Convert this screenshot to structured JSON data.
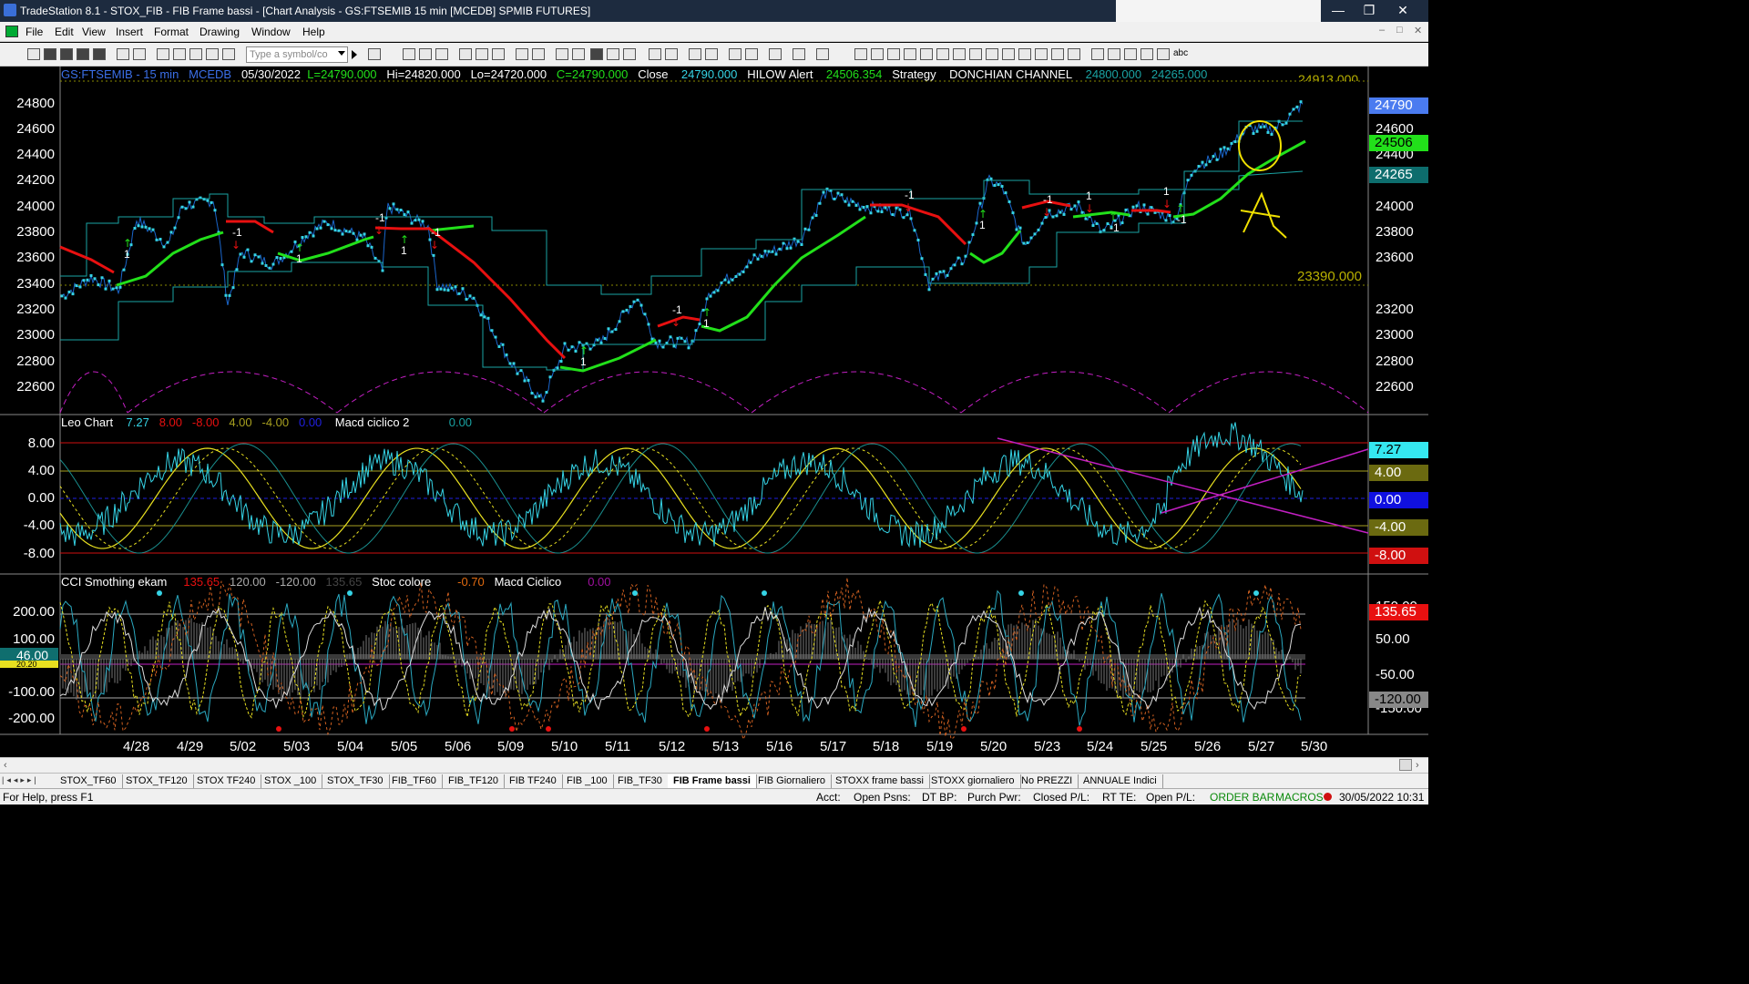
{
  "window": {
    "title": "TradeStation 8.1 - STOX_FIB - FIB Frame bassi - [Chart Analysis - GS:FTSEMIB  15 min  [MCEDB] SPMIB FUTURES]",
    "minimize": "—",
    "restore": "❐",
    "close": "✕"
  },
  "menu": {
    "items": [
      "File",
      "Edit",
      "View",
      "Insert",
      "Format",
      "Drawing",
      "Window",
      "Help"
    ],
    "right_controls": [
      "–",
      "□",
      "✕"
    ]
  },
  "toolbar": {
    "symbol_placeholder": "Type a symbol/co",
    "abc_label": "abc"
  },
  "price_panel": {
    "symbol": "GS:FTSEMIB - 15 min",
    "exchange": "MCEDB",
    "date": "05/30/2022",
    "last": "L=24790.000",
    "high": "Hi=24820.000",
    "low": "Lo=24720.000",
    "close": "C=24790.000",
    "close_label": "Close",
    "close_value": "24790.000",
    "alert_label": "HILOW Alert",
    "alert_value": "24506.354",
    "strategy_label": "Strategy",
    "donchian_label": "DONCHIAN CHANNEL",
    "donchian_hi": "24800.000",
    "donchian_lo": "24265.000",
    "top_value": "24913.000",
    "level_value": "23390.000",
    "y_ticks": [
      "24800",
      "24600",
      "24400",
      "24200",
      "24000",
      "23800",
      "23600",
      "23400",
      "23200",
      "23000",
      "22800",
      "22600"
    ],
    "badges": [
      "24790",
      "24506",
      "24265"
    ],
    "trade_markers": [
      "1",
      "-1",
      "1",
      "-1",
      "1",
      "-1",
      "1",
      "-1",
      "1",
      "-1",
      "1",
      "-1",
      "1",
      "-1",
      "1",
      "-1",
      "1",
      "-1",
      "1"
    ]
  },
  "osc_panel": {
    "name": "Leo Chart",
    "v1": "7.27",
    "v2": "8.00",
    "v3": "-8.00",
    "v4": "4.00",
    "v5": "-4.00",
    "v6": "0.00",
    "macd_label": "Macd ciclico 2",
    "macd_value": "0.00",
    "y_ticks": [
      "8.00",
      "4.00",
      "0.00",
      "-4.00",
      "-8.00"
    ],
    "badges": [
      "7.27",
      "4.00",
      "0.00",
      "-4.00",
      "-8.00"
    ]
  },
  "cci_panel": {
    "name": "CCI Smothing ekam",
    "v1": "135.65",
    "v2": "120.00",
    "v3": "-120.00",
    "v4": "135.65",
    "stoc_label": "Stoc colore",
    "stoc_value": "-0.70",
    "macd_label": "Macd Ciclico",
    "macd_value": "0.00",
    "y_ticks_left": [
      "200.00",
      "100.00",
      "-100.00",
      "-200.00"
    ],
    "y_ticks_right": [
      "150.00",
      "50.00",
      "-50.00",
      "-150.00"
    ],
    "badges_right": [
      "135.65",
      "-120.00"
    ],
    "badges_left": [
      "46.00",
      "20.20"
    ]
  },
  "x_axis": [
    "4/28",
    "4/29",
    "5/02",
    "5/03",
    "5/04",
    "5/05",
    "5/06",
    "5/09",
    "5/10",
    "5/11",
    "5/12",
    "5/13",
    "5/16",
    "5/17",
    "5/18",
    "5/19",
    "5/20",
    "5/23",
    "5/24",
    "5/25",
    "5/26",
    "5/27",
    "5/30"
  ],
  "tabs": [
    "STOX_TF60",
    "STOX_TF120",
    "STOX TF240",
    "STOX _100",
    "STOX_TF30",
    "FIB_TF60",
    "FIB_TF120",
    "FIB TF240",
    "FIB _100",
    "FIB_TF30",
    "FIB Frame bassi",
    "FIB Giornaliero",
    "STOXX frame bassi",
    "STOXX giornaliero",
    "No PREZZI",
    "ANNUALE Indici"
  ],
  "active_tab": "FIB Frame bassi",
  "status": {
    "help": "For Help, press F1",
    "acct": "Acct:",
    "open_psns": "Open Psns:",
    "dt_bp": "DT BP:",
    "purch_pwr": "Purch Pwr:",
    "closed_pl": "Closed P/L:",
    "rt_te": "RT TE:",
    "open_pl": "Open P/L:",
    "order_bar": "ORDER BAR",
    "macros": "MACROS",
    "datetime": "30/05/2022 10:31"
  },
  "colors": {
    "cyan": "#35d3e5",
    "green": "#22e01a",
    "red": "#e81010",
    "yellow": "#e8e020",
    "magenta": "#c21fc2",
    "teal": "#1aa3a3",
    "title_bg": "#1d2b3f"
  }
}
